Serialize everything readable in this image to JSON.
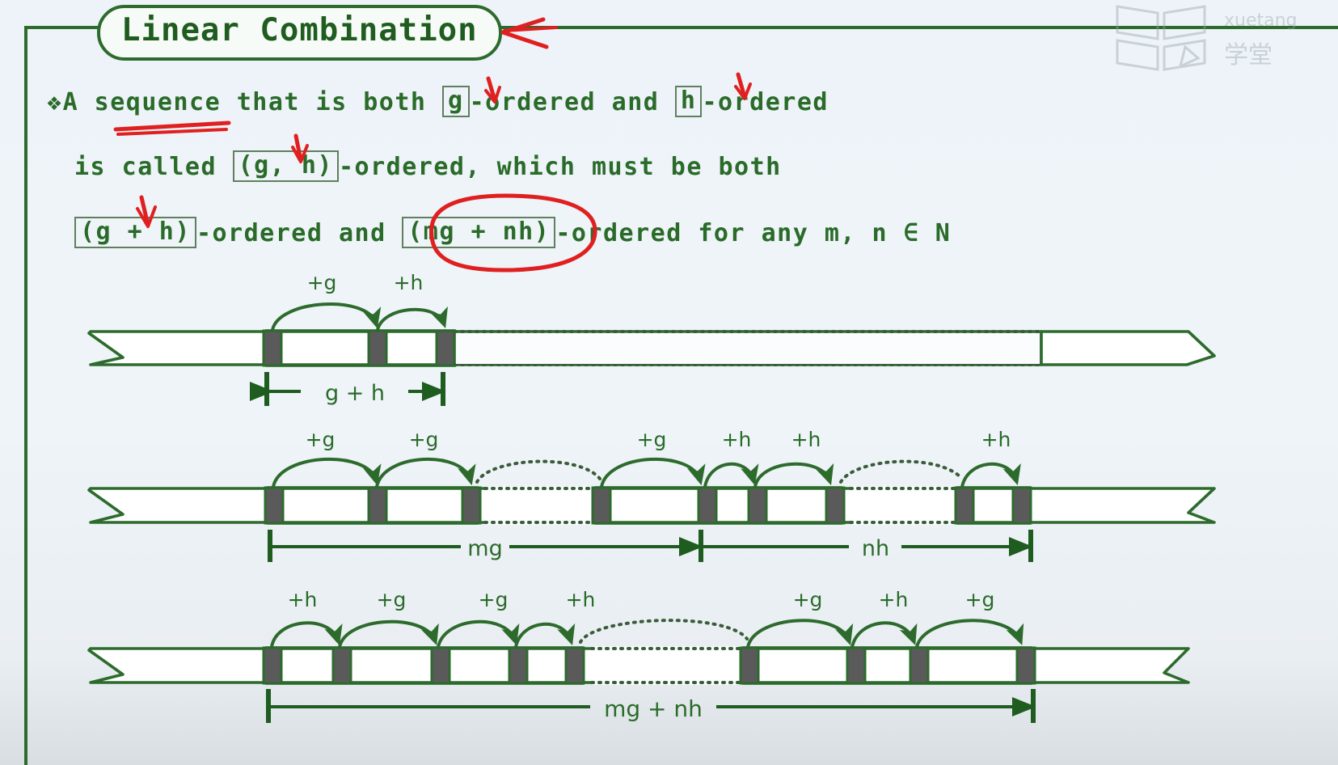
{
  "slide": {
    "title": "Linear Combination",
    "bullet_marker": "❖",
    "lines": [
      {
        "id": "line1",
        "parts": [
          {
            "t": "A sequence that is both ",
            "kind": "text"
          },
          {
            "t": "g",
            "kind": "boxed"
          },
          {
            "t": "-ordered and ",
            "kind": "text"
          },
          {
            "t": "h",
            "kind": "boxed"
          },
          {
            "t": "-ordered",
            "kind": "text"
          }
        ]
      },
      {
        "id": "line2",
        "parts": [
          {
            "t": "is called ",
            "kind": "text"
          },
          {
            "t": "(g, h)",
            "kind": "boxed"
          },
          {
            "t": "-ordered, which must be both",
            "kind": "text"
          }
        ]
      },
      {
        "id": "line3",
        "parts": [
          {
            "t": "",
            "kind": "text"
          },
          {
            "t": "(g + h)",
            "kind": "boxed"
          },
          {
            "t": "-ordered and ",
            "kind": "text"
          },
          {
            "t": "(mg + nh)",
            "kind": "boxed"
          },
          {
            "t": "-ordered for any m, n ∈ N",
            "kind": "text"
          }
        ]
      }
    ],
    "full_text_line1": "A sequence that is both g-ordered and h-ordered",
    "full_text_line2": "is called (g, h)-ordered, which must be both",
    "full_text_line3": "(g + h)-ordered and (mg + nh)-ordered for any m, n ∈ N"
  },
  "colors": {
    "green": "#2d6b2d",
    "green_dark": "#1f5c1f",
    "red": "#e02020",
    "tick_gray": "#5a5a5a",
    "ribbon_fill": "#ffffff",
    "background": "#eef3f7"
  },
  "annotations": {
    "red_arrow_to_title": "arrow pointing left at title",
    "red_underline_word": "sequence",
    "red_arrow_g": "arrow pointing down at g",
    "red_arrow_h": "arrow pointing down at h",
    "red_arrow_gh_pair": "arrow pointing down at (g, h)",
    "red_arrow_g_plus_h": "arrow pointing down at (g + h)",
    "red_circle_term": "(mg + nh)"
  },
  "diagrams": [
    {
      "id": "row1",
      "name": "g-plus-h-sequence",
      "arc_labels": [
        "+g",
        "+h"
      ],
      "measure_label": "g + h",
      "ticks": [
        330,
        460,
        540
      ],
      "ellipsis_after_index": 2,
      "tail_start": 1288
    },
    {
      "id": "row2",
      "name": "mg-plus-nh-sequence",
      "arc_labels": [
        "+g",
        "+g",
        "+g",
        "+h",
        "+h",
        "+h"
      ],
      "measure_labels": [
        "mg",
        "nh"
      ],
      "ticks": [
        332,
        460,
        588,
        737,
        868,
        930,
        1040,
        1185,
        1272
      ],
      "ellipsis_gaps": [
        [
          588,
          737
        ],
        [
          1040,
          1185
        ]
      ]
    },
    {
      "id": "row3",
      "name": "mg-plus-nh-interleaved-sequence",
      "arc_labels": [
        "+h",
        "+g",
        "+g",
        "+h",
        "+g",
        "+h",
        "+g"
      ],
      "measure_label": "mg + nh",
      "ticks": [
        330,
        423,
        545,
        641,
        718,
        920,
        1065,
        1140,
        1273
      ],
      "ellipsis_gaps": [
        [
          718,
          920
        ]
      ]
    }
  ],
  "watermark": {
    "brand_latin": "xuetang",
    "brand_cjk": "学堂",
    "icon": "book-logo-icon"
  }
}
